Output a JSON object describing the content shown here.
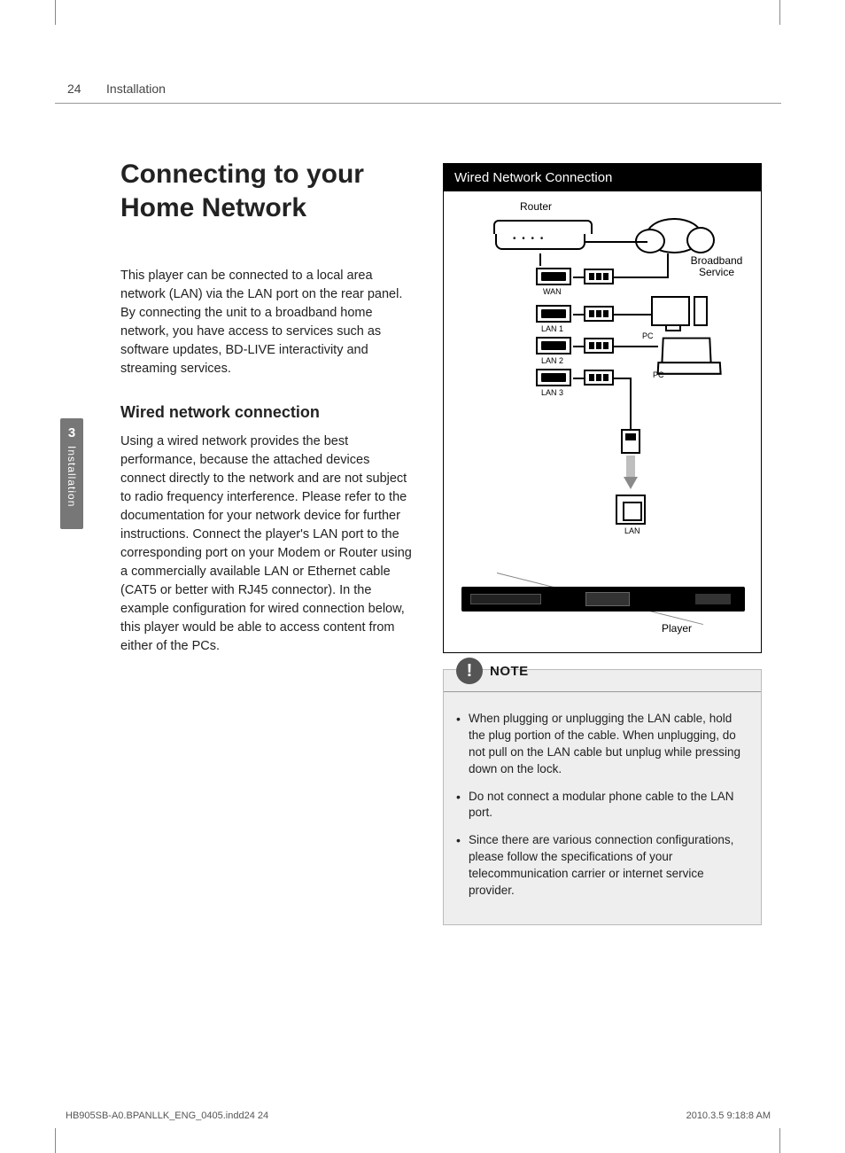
{
  "header": {
    "page_number": "24",
    "section": "Installation"
  },
  "side_tab": {
    "chapter": "3",
    "label": "Installation"
  },
  "left": {
    "title": "Connecting to your Home Network",
    "intro": "This player can be connected to a local area network (LAN) via the LAN port on the rear panel.\nBy connecting the unit to a broadband home network, you have access to services such as software updates, BD-LIVE interactivity and streaming services.",
    "sub_heading": "Wired network connection",
    "body": "Using a wired network provides the best performance, because the attached devices connect directly to the network and are not subject to radio frequency interference. Please refer to the documentation for your network device for further instructions. Connect the player's LAN port to the corresponding port on your Modem or Router using a commercially available LAN or Ethernet cable (CAT5 or better with RJ45 connector). In the example configuration for wired connection below, this player would be able to access content from either of the PCs."
  },
  "diagram": {
    "title": "Wired Network Connection",
    "labels": {
      "router": "Router",
      "broadband": "Broadband Service",
      "wan": "WAN",
      "lan1": "LAN 1",
      "lan2": "LAN 2",
      "lan3": "LAN 3",
      "pc1": "PC",
      "pc2": "PC",
      "lan_port": "LAN",
      "player": "Player"
    }
  },
  "note": {
    "label": "NOTE",
    "items": [
      "When plugging or unplugging the LAN cable, hold the plug portion of the cable. When unplugging, do not pull on the LAN cable but unplug while pressing down on the lock.",
      "Do not connect a modular phone cable to the LAN port.",
      "Since there are various connection configurations, please follow the specifications of your telecommunication carrier or internet service provider."
    ]
  },
  "footer": {
    "file": "HB905SB-A0.BPANLLK_ENG_0405.indd24   24",
    "timestamp": "2010.3.5   9:18:8 AM"
  }
}
